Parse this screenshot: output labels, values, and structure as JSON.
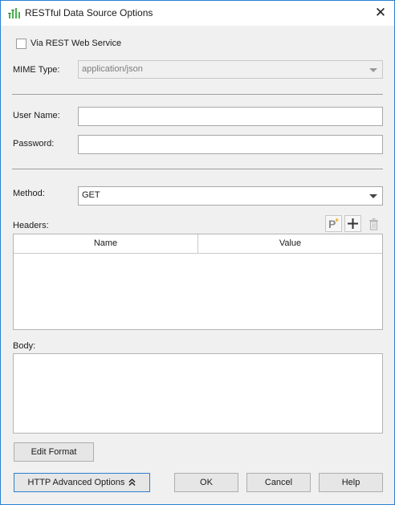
{
  "window": {
    "title": "RESTful Data Source Options",
    "close_glyph": "✕"
  },
  "rest": {
    "via_label": "Via REST Web Service",
    "via_checked": false
  },
  "mime": {
    "label": "MIME Type:",
    "value": "application/json"
  },
  "auth": {
    "user_label": "User Name:",
    "user_value": "",
    "password_label": "Password:",
    "password_value": ""
  },
  "method": {
    "label": "Method:",
    "value": "GET"
  },
  "headers": {
    "label": "Headers:",
    "columns": [
      "Name",
      "Value"
    ],
    "toolbar": {
      "parameter_icon": "parameter-add-icon",
      "add_icon": "plus-icon",
      "delete_icon": "trash-icon"
    }
  },
  "body": {
    "label": "Body:",
    "value": ""
  },
  "buttons": {
    "edit_format": "Edit Format",
    "http_advanced": "HTTP Advanced Options",
    "http_advanced_icon": "double-chevron-up-icon",
    "ok": "OK",
    "cancel": "Cancel",
    "help": "Help"
  },
  "colors": {
    "accent": "#2b7fd0",
    "app_icon": "#4caf50",
    "parameter_icon": "#e8a317"
  }
}
